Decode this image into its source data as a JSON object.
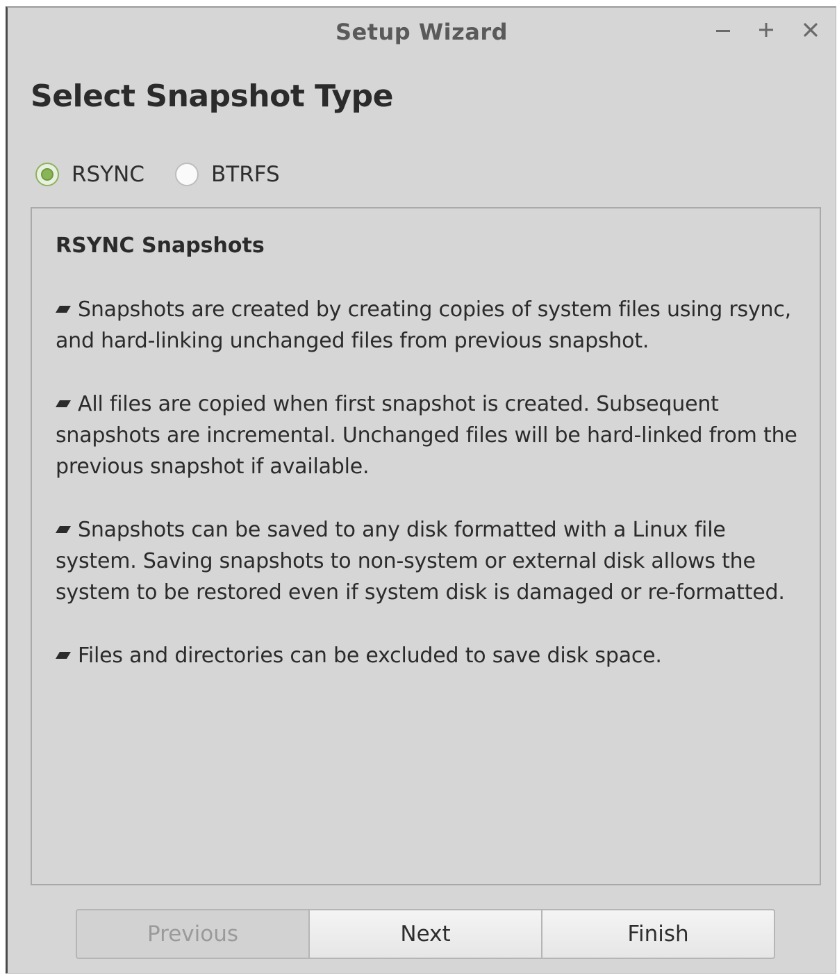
{
  "window": {
    "title": "Setup Wizard",
    "controls": [
      "minimize-icon",
      "maximize-icon",
      "close-icon"
    ]
  },
  "page": {
    "heading": "Select Snapshot Type"
  },
  "snapshot_type": {
    "options": [
      {
        "label": "RSYNC",
        "selected": true
      },
      {
        "label": "BTRFS",
        "selected": false
      }
    ]
  },
  "description": {
    "title": "RSYNC Snapshots",
    "items": [
      "Snapshots are created by creating copies of system files using rsync, and hard-linking unchanged files from previous snapshot.",
      "All files are copied when first snapshot is created. Subsequent snapshots are incremental. Unchanged files will be hard-linked from the previous snapshot if available.",
      "Snapshots can be saved to any disk formatted with a Linux file system. Saving snapshots to non-system or external disk allows the system to be restored even if system disk is damaged or re-formatted.",
      "Files and directories can be excluded to save disk space."
    ]
  },
  "buttons": {
    "previous": "Previous",
    "next": "Next",
    "finish": "Finish"
  },
  "colors": {
    "window_bg": "#d6d6d6",
    "accent_green": "#8ab557",
    "text": "#2b2b2b"
  }
}
